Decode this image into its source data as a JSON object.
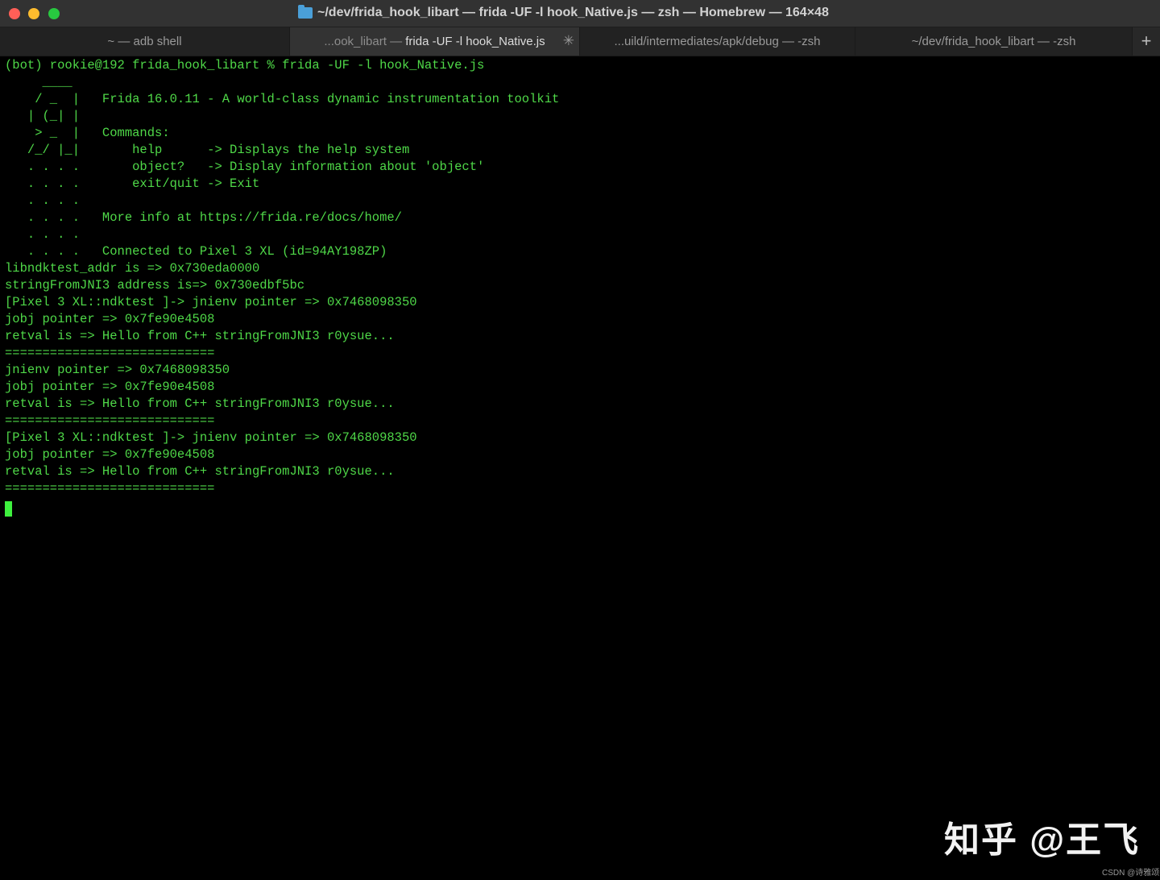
{
  "window": {
    "title": "~/dev/frida_hook_libart — frida -UF -l hook_Native.js — zsh — Homebrew — 164×48"
  },
  "tabs": [
    {
      "label": "~ — adb shell"
    },
    {
      "label_prefix": "...ook_libart — ",
      "label": "frida -UF -l hook_Native.js"
    },
    {
      "label": "...uild/intermediates/apk/debug — -zsh"
    },
    {
      "label": "~/dev/frida_hook_libart — -zsh"
    }
  ],
  "new_tab_label": "+",
  "terminal": {
    "lines": [
      "(bot) rookie@192 frida_hook_libart % frida -UF -l hook_Native.js",
      "     ____",
      "    / _  |   Frida 16.0.11 - A world-class dynamic instrumentation toolkit",
      "   | (_| |",
      "    > _  |   Commands:",
      "   /_/ |_|       help      -> Displays the help system",
      "   . . . .       object?   -> Display information about 'object'",
      "   . . . .       exit/quit -> Exit",
      "   . . . .",
      "   . . . .   More info at https://frida.re/docs/home/",
      "   . . . .",
      "   . . . .   Connected to Pixel 3 XL (id=94AY198ZP)",
      "libndktest_addr is => 0x730eda0000",
      "stringFromJNI3 address is=> 0x730edbf5bc",
      "[Pixel 3 XL::ndktest ]-> jnienv pointer => 0x7468098350",
      "jobj pointer => 0x7fe90e4508",
      "retval is => Hello from C++ stringFromJNI3 r0ysue...",
      "============================",
      "jnienv pointer => 0x7468098350",
      "jobj pointer => 0x7fe90e4508",
      "retval is => Hello from C++ stringFromJNI3 r0ysue...",
      "============================",
      "[Pixel 3 XL::ndktest ]-> jnienv pointer => 0x7468098350",
      "jobj pointer => 0x7fe90e4508",
      "retval is => Hello from C++ stringFromJNI3 r0ysue...",
      "============================"
    ]
  },
  "watermark": "知乎 @王飞",
  "csdn_mark": "CSDN @诗雅颂",
  "colors": {
    "terminal_text": "#4fd848",
    "terminal_bg": "#000000",
    "cursor": "#3ef03e"
  }
}
